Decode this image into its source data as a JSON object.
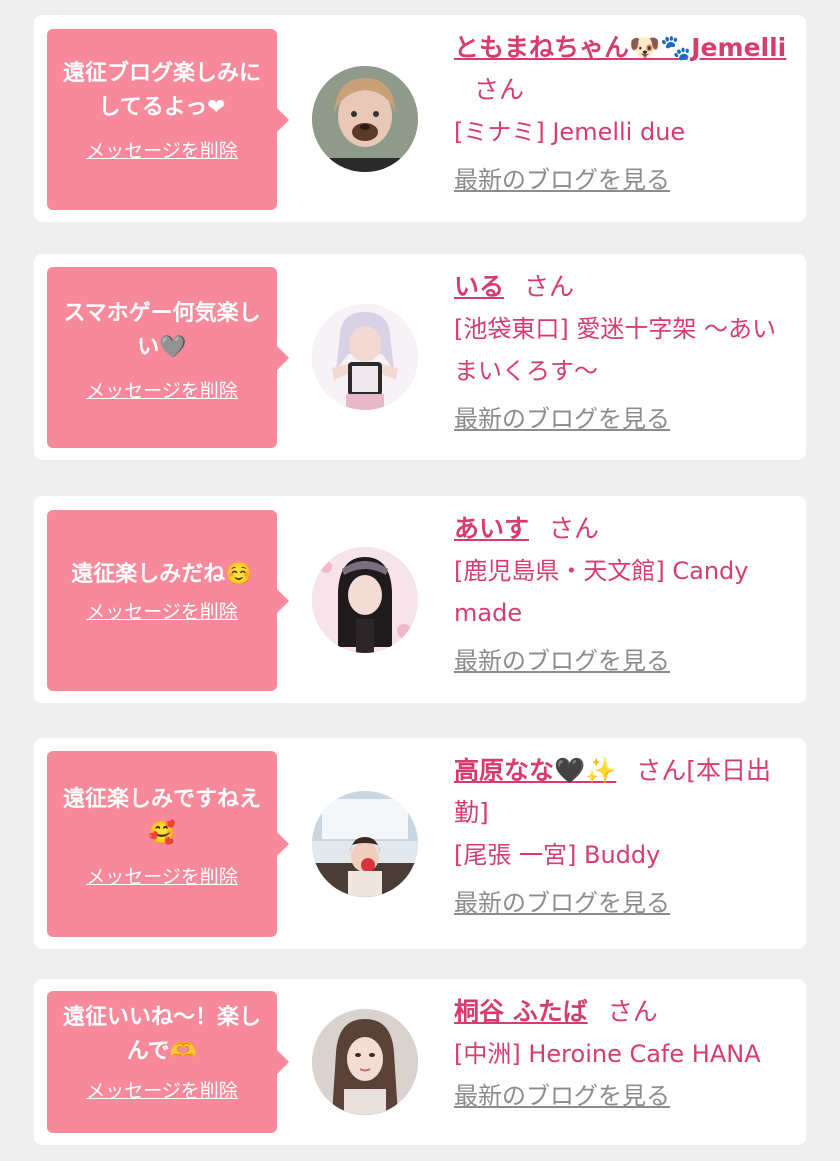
{
  "delete_label": "メッセージを削除",
  "blog_label": "最新のブログを見る",
  "san_label": "さん",
  "colors": {
    "background": "#efeff0",
    "bubble": "#f7899a",
    "accent": "#d63d6e",
    "muted": "#8c8c8c"
  },
  "items": [
    {
      "message": "遠征ブログ楽しみにしてるよっ❤",
      "name": "ともまねちゃん🐶🐾Jemelli",
      "name_suffix": "",
      "shop": "[ミナミ] Jemelli due",
      "avatar_icon": "avatar-photo"
    },
    {
      "message": "スマホゲー何気楽しい🩶",
      "name": "いる",
      "name_suffix": "",
      "shop": "[池袋東口] 愛迷十字架 〜あいまいくろす〜",
      "avatar_icon": "avatar-photo"
    },
    {
      "message": "遠征楽しみだね☺️",
      "name": "あいす",
      "name_suffix": "",
      "shop": "[鹿児島県・天文館] Candy made",
      "avatar_icon": "avatar-photo"
    },
    {
      "message": "遠征楽しみですねえ🥰",
      "name": "高原なな🖤✨",
      "name_suffix": "[本日出勤]",
      "shop": "[尾張 一宮] Buddy",
      "avatar_icon": "avatar-photo"
    },
    {
      "message": "遠征いいね〜！楽しんで🫶",
      "name": "桐谷 ふたば",
      "name_suffix": "",
      "shop": "[中洲] Heroine Cafe HANA",
      "avatar_icon": "avatar-photo"
    }
  ]
}
